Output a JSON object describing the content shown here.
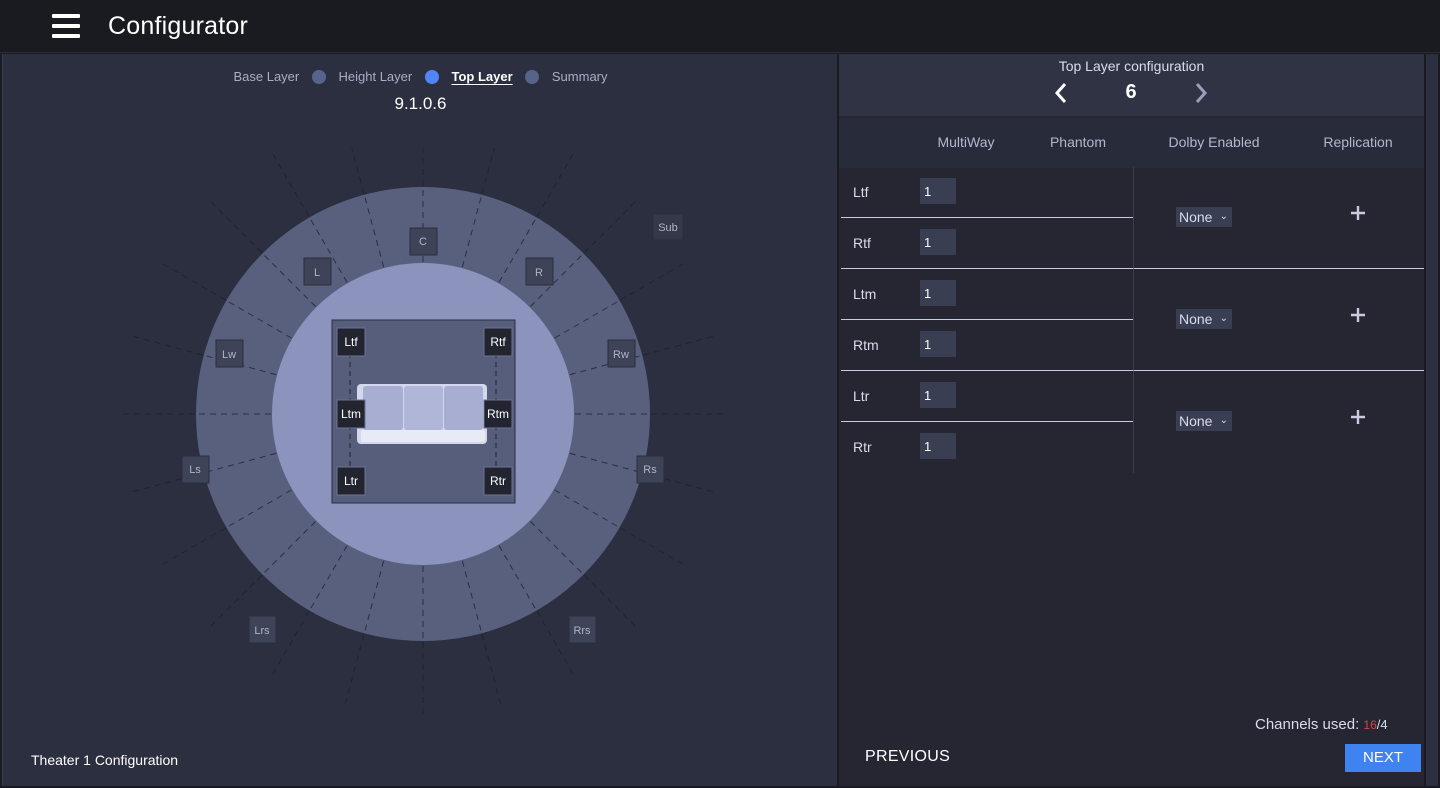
{
  "app": {
    "title": "Configurator",
    "theater_name": "Theater 1 Configuration"
  },
  "stepper": {
    "steps": [
      {
        "label": "Base Layer",
        "active": false
      },
      {
        "label": "Height Layer",
        "active": false
      },
      {
        "label": "Top Layer",
        "active": true
      },
      {
        "label": "Summary",
        "active": false
      }
    ],
    "config_code": "9.1.0.6"
  },
  "diagram": {
    "outer_speakers": [
      "C",
      "L",
      "R",
      "Lw",
      "Rw",
      "Ls",
      "Rs",
      "Lrs",
      "Rrs",
      "Sub"
    ],
    "top_speakers": [
      "Ltf",
      "Rtf",
      "Ltm",
      "Rtm",
      "Ltr",
      "Rtr"
    ]
  },
  "panel": {
    "title": "Top Layer configuration",
    "count": "6",
    "columns": [
      "MultiWay",
      "Phantom",
      "Dolby Enabled",
      "Replication"
    ],
    "rows": [
      {
        "label": "Ltf",
        "multiway": "1"
      },
      {
        "label": "Rtf",
        "multiway": "1"
      },
      {
        "label": "Ltm",
        "multiway": "1"
      },
      {
        "label": "Rtm",
        "multiway": "1"
      },
      {
        "label": "Ltr",
        "multiway": "1"
      },
      {
        "label": "Rtr",
        "multiway": "1"
      }
    ],
    "groups": [
      {
        "dolby": "None"
      },
      {
        "dolby": "None"
      },
      {
        "dolby": "None"
      }
    ],
    "channels_label": "Channels used:",
    "channels_used": "16",
    "channels_total": "/4"
  },
  "nav": {
    "previous": "PREVIOUS",
    "next": "NEXT"
  },
  "colors": {
    "accent": "#4f86f7",
    "panel": "#2b2f3f",
    "warning": "#d04848"
  },
  "icons": {
    "menu": "hamburger-icon",
    "prev": "chevron-left-icon",
    "next": "chevron-right-icon",
    "add": "plus-icon",
    "dropdown": "chevron-down-icon"
  }
}
